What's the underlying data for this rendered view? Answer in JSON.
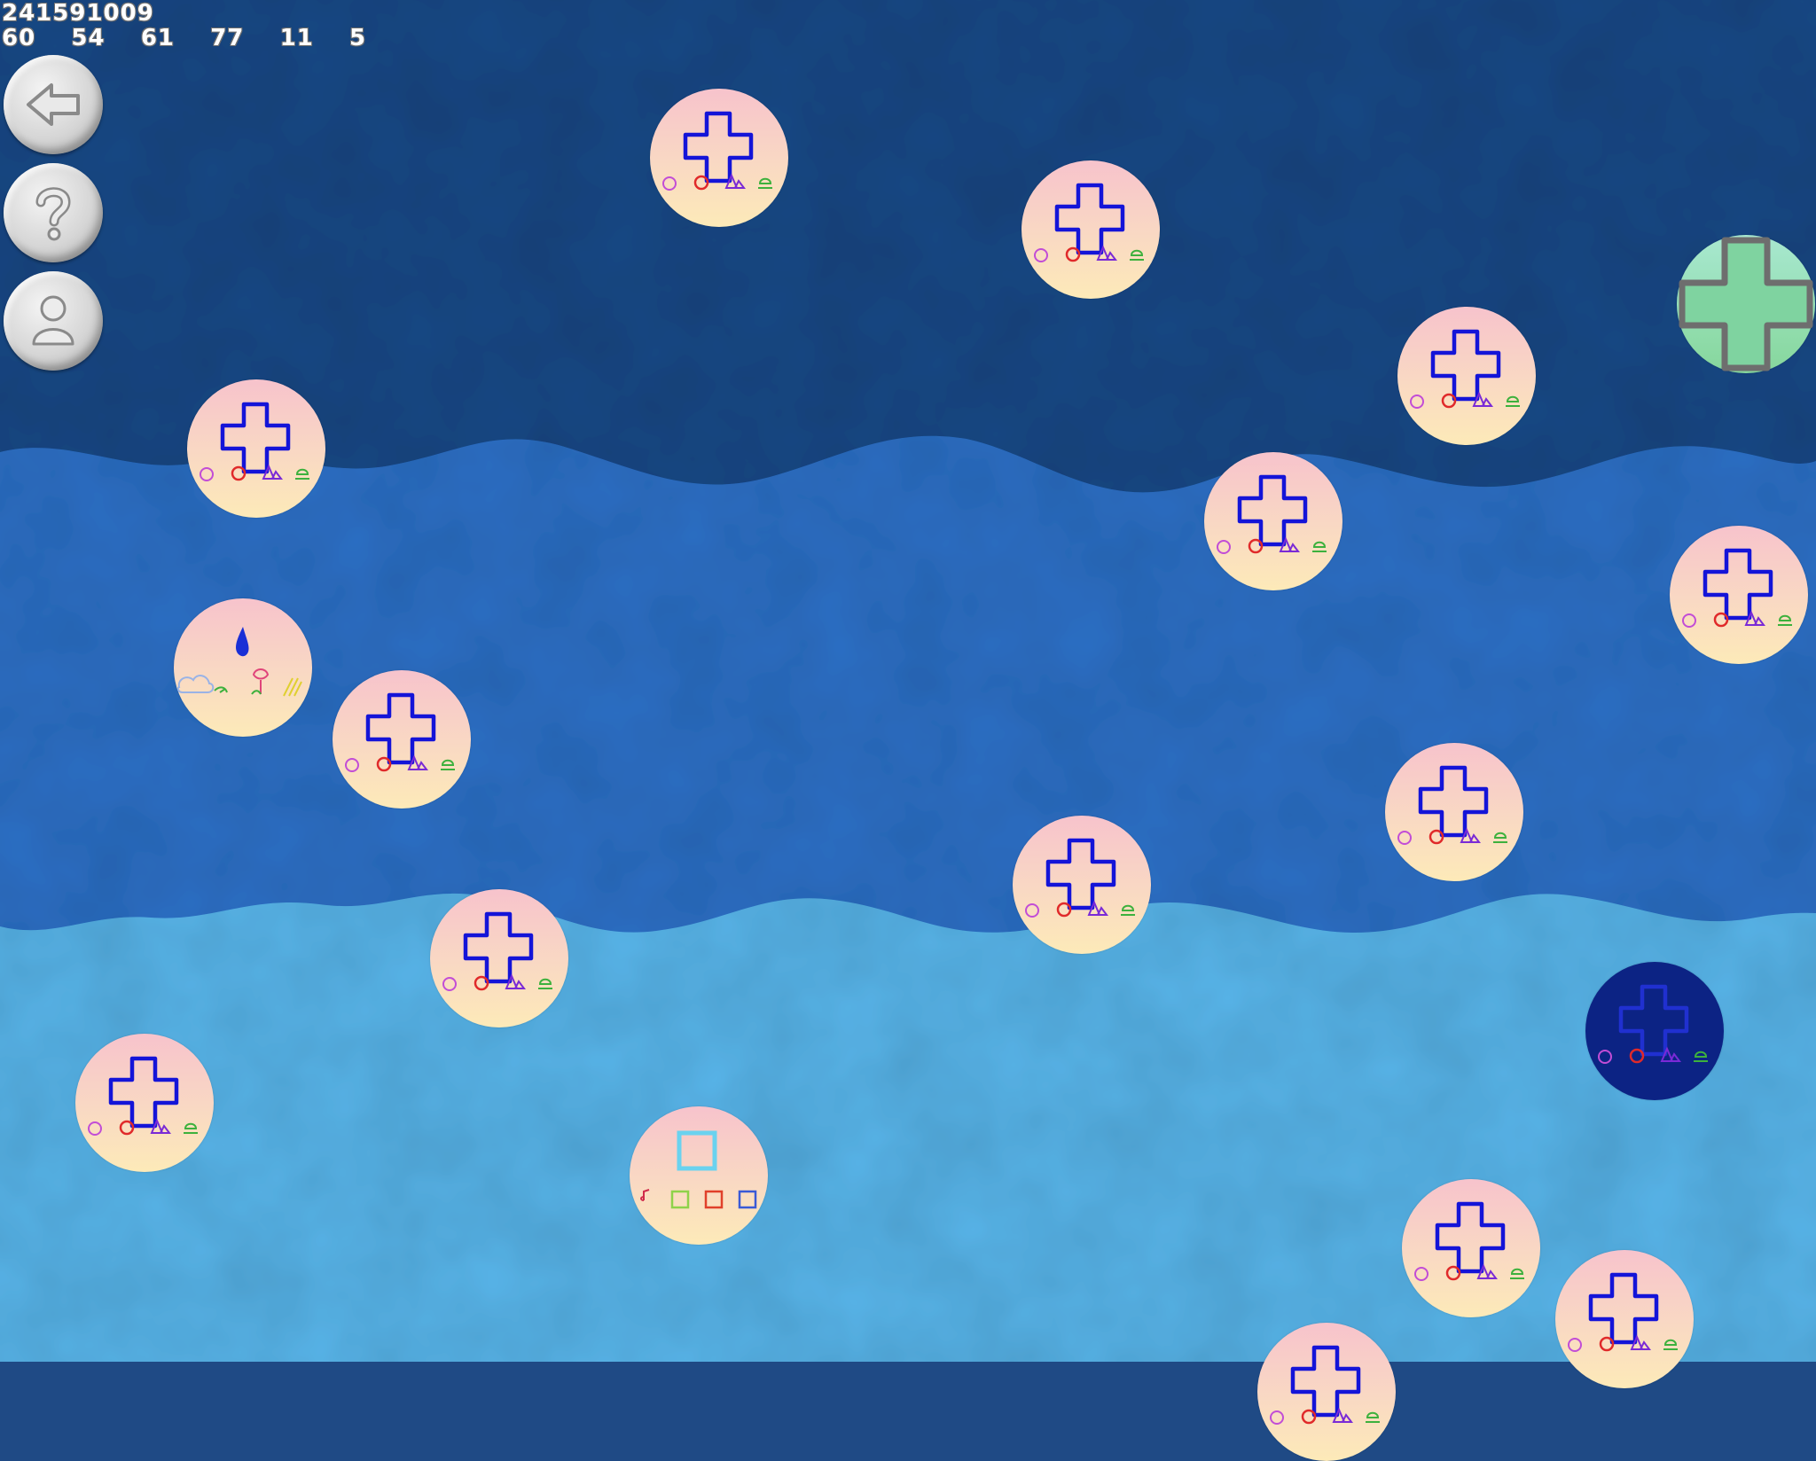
{
  "hud": {
    "top_number": "241591009",
    "row_numbers": [
      "60",
      "54",
      "61",
      "77",
      "11",
      "5"
    ]
  },
  "side_buttons": [
    {
      "name": "back-button",
      "icon": "back-arrow-icon"
    },
    {
      "name": "help-button",
      "icon": "question-mark-icon"
    },
    {
      "name": "profile-button",
      "icon": "person-icon"
    }
  ],
  "colors": {
    "band_top": "#1f4a85",
    "band_middle": "#2f6fc5",
    "band_bottom": "#58b4e8",
    "bubble_pink": "#f7c3cc",
    "bubble_cream": "#fdeab8",
    "cross_stroke": "#1414d8",
    "selected_bubble": "#0c2384",
    "goal_bubble": "#8fdcad"
  },
  "bubbles_icon_types": [
    "cross-level-icon",
    "water-drop-level-icon",
    "square-level-icon",
    "goal-cross-icon"
  ]
}
